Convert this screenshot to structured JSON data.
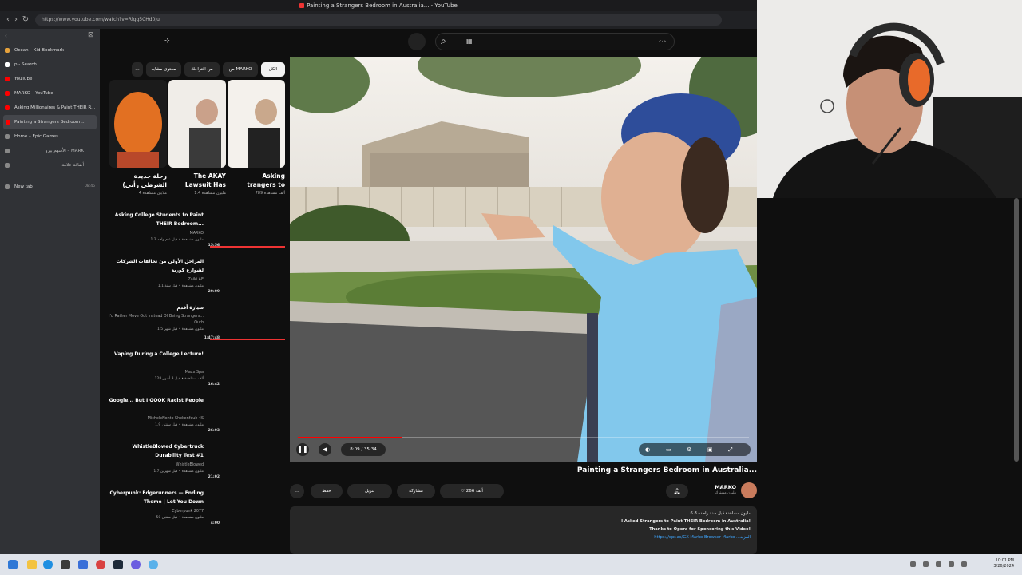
{
  "browser": {
    "window_title": "Painting a Strangers Bedroom in Australia... - YouTube",
    "url": "https://www.youtube.com/watch?v=Rlgg5CHd0ju"
  },
  "tabs": [
    {
      "label": "Ocean – Kid Bookmark",
      "color": "#e6a23c"
    },
    {
      "label": "p - Search",
      "color": "#ffffff"
    },
    {
      "label": "YouTube",
      "color": "#ff0000"
    },
    {
      "label": "MARKO – YouTube",
      "color": "#ff0000"
    },
    {
      "label": "Asking Millionaires & Paint THEIR R...",
      "color": "#ff0000"
    },
    {
      "label": "Painting a Strangers Bedroom ...",
      "color": "#ff0000",
      "active": true
    },
    {
      "label": "Home – Epic Games",
      "color": "#888888"
    },
    {
      "label": "الأسهم بيرو – MARK",
      "color": "#888888",
      "arabic": true
    },
    {
      "label": "أضافة علامة",
      "color": "#888888",
      "arabic": true
    },
    {
      "label": "New tab",
      "color": "#888888",
      "time": "08:45"
    }
  ],
  "youtube": {
    "search_placeholder": "بحث",
    "chips": [
      "الكل",
      "من MARKO",
      "من اقتراحك",
      "محتوى مشابه",
      "…"
    ],
    "shorts": [
      {
        "title": "Asking",
        "title2": "trangers to",
        "views": "789 ألف مشاهدة"
      },
      {
        "title": "The AKAY",
        "title2": "Lawsuit Has",
        "views": "1.4 مليون مشاهدة"
      },
      {
        "title": "رحلة جديدة",
        "title2": "(الشرطي رأني",
        "views": "4 ملايين مشاهدة"
      }
    ],
    "videos": [
      {
        "title": "Asking College Students to Paint THEIR Bedroom...",
        "channel": "MARKO",
        "meta": "1.2 مليون مشاهدة • قبل عام واحد",
        "duration": "15:56",
        "progress": 1.0
      },
      {
        "title": "المراحل الأولى من تحالفات الشركات لشوارع كورية",
        "channel": "Zaiki AE",
        "meta": "1.1 مليون مشاهدة • قبل سنة",
        "duration": "20:09",
        "progress": 0
      },
      {
        "title": "سيارة أقدم",
        "channel": "Outb",
        "meta": "1.5 مليون مشاهدة • قبل شهر",
        "duration": "1:47:48",
        "progress": 1.0,
        "subtitle": "I'd Rather Move Out Instead Of Being Strangers..."
      },
      {
        "title": "Vaping During a College Lecture!",
        "channel": "Maxx Spa",
        "meta": "128 ألف مشاهدة • قبل 3 أشهر",
        "duration": "16:42",
        "progress": 0
      },
      {
        "title": "Google... But I GOOK Racist People",
        "channel": "MicheleNonto Shekenfeuh 4S",
        "meta": "1.9 مليون مشاهدة • قبل سنتين",
        "duration": "26:03",
        "progress": 0
      },
      {
        "title": "WhistleBlowed Cybertruck Durability Test #1",
        "channel": "WhistleBlowed",
        "meta": "1.7 مليون مشاهدة • قبل شهرين",
        "duration": "21:02",
        "progress": 0
      },
      {
        "title": "Cyberpunk: Edgerunners — Ending Theme | Let You Down",
        "channel": "Cyberpunk 2077",
        "meta": "50 مليون مشاهدة • قبل سنتين",
        "duration": "4:00",
        "progress": 0
      }
    ],
    "player": {
      "time": "8:09 / 35:34",
      "progress": 0.23
    },
    "video_title": "Painting a Strangers Bedroom in Australia...",
    "channel": {
      "name": "MARKO",
      "subs": "مليون مشترك"
    },
    "actions": {
      "like": "266 ألف",
      "share": "مشاركة",
      "download": "تنزيل",
      "save": "حفظ",
      "more": "…"
    },
    "description": [
      "6.8 مليون مشاهدة  قبل سنة واحدة",
      "I Asked Strangers to Paint THEIR Bedroom in Australia!",
      "Thanks to Opera for Sponsoring this Video!",
      "https://opr.as/GX-Marko-Browser-Marko   ...المزيد"
    ]
  },
  "taskbar": {
    "time": "10:01 PM",
    "date": "3/26/2024"
  }
}
